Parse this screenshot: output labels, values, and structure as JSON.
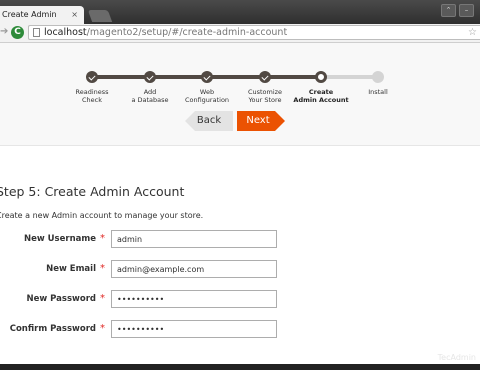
{
  "browser": {
    "tab_title": "Create Admin Account",
    "tab_close": "×",
    "url_host": "localhost",
    "url_path": "/magento2/setup/#/create-admin-account",
    "window_controls": [
      "⌃",
      "–"
    ]
  },
  "progress": {
    "steps": [
      {
        "label": "Readiness\nCheck",
        "state": "done"
      },
      {
        "label": "Add\na Database",
        "state": "done"
      },
      {
        "label": "Web\nConfiguration",
        "state": "done"
      },
      {
        "label": "Customize\nYour Store",
        "state": "done"
      },
      {
        "label": "Create\nAdmin Account",
        "state": "current"
      },
      {
        "label": "Install",
        "state": "todo"
      }
    ]
  },
  "nav": {
    "back_label": "Back",
    "next_label": "Next"
  },
  "form": {
    "title": "Step 5: Create Admin Account",
    "description": "Create a new Admin account to manage your store.",
    "required_mark": "*",
    "fields": [
      {
        "label": "New Username",
        "value": "admin"
      },
      {
        "label": "New Email",
        "value": "admin@example.com"
      },
      {
        "label": "New Password",
        "value": "••••••••••"
      },
      {
        "label": "Confirm Password",
        "value": "••••••••••"
      }
    ]
  },
  "watermark": "TecAdmin",
  "colors": {
    "accent": "#eb5202",
    "progress_done": "#514943",
    "progress_todo": "#d4d4d4",
    "required": "#e02b27"
  }
}
